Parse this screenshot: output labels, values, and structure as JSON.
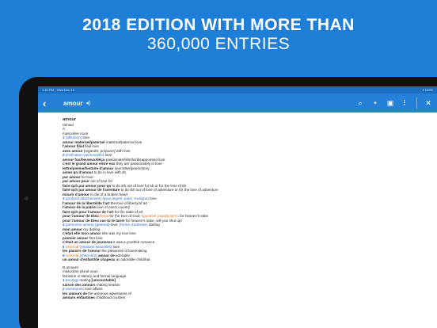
{
  "headline": {
    "line1": "2018 EDITION WITH MORE THAN",
    "line2": "360,000 ENTRIES"
  },
  "status_bar": {
    "time": "1:42 PM",
    "date": "Wed Dec 13",
    "right": "▾ 100%"
  },
  "toolbar": {
    "back_icon": "‹",
    "search_term": "amour",
    "audio_icon": "◂)",
    "search_icon": "⌕",
    "mic_icon": "•",
    "camera_icon": "▣",
    "menu_icon": "⠇",
    "close_icon": "✕"
  },
  "entry": {
    "headword": "amour",
    "pronunciation": "/amuʁ/",
    "sense_a": "A",
    "sense_a_pos": "masculine noun",
    "lines": [
      [
        {
          "c": "num",
          "t": "1 "
        },
        {
          "c": "blue",
          "t": "(affection) "
        },
        {
          "t": "love"
        }
      ],
      [
        {
          "c": "b",
          "t": "amour maternel/paternel "
        },
        {
          "t": "maternal/paternal love"
        }
      ],
      [
        {
          "c": "b",
          "t": "l'amour filial "
        },
        {
          "t": "filial love"
        }
      ],
      [
        {
          "c": "b",
          "t": "avec amour "
        },
        {
          "c": "ital",
          "t": "[regarder, préparer] "
        },
        {
          "t": "with love"
        }
      ],
      [
        {
          "c": "num",
          "t": "2 "
        },
        {
          "c": "blue",
          "t": "(inclination personnelle) "
        },
        {
          "t": "love"
        }
      ],
      [
        {
          "c": "b",
          "t": "amour fou/heureux/déçu "
        },
        {
          "t": "passionate/blissful/disappointed love"
        }
      ],
      [
        {
          "c": "b",
          "t": "c'est le grand amour entre eux "
        },
        {
          "t": "they are passionately in love"
        }
      ],
      [
        {
          "c": "b",
          "t": "lettre/poème/histoire d'amour "
        },
        {
          "t": "love letter/poem/story"
        }
      ],
      [
        {
          "c": "b",
          "t": "aimer qn d'amour "
        },
        {
          "t": "to be in love with sb"
        }
      ],
      [
        {
          "c": "b",
          "t": "par amour "
        },
        {
          "t": "for love"
        }
      ],
      [
        {
          "c": "b",
          "t": "par amour pour "
        },
        {
          "t": "out of love for"
        }
      ],
      [
        {
          "c": "b",
          "t": "faire qch par amour pour qn "
        },
        {
          "t": "to do sth out of love for sb or for the love of sb"
        }
      ],
      [
        {
          "c": "b",
          "t": "faire qch par amour de l'aventure "
        },
        {
          "t": "to do sth out of love of adventure or for the love of adventure"
        }
      ],
      [
        {
          "c": "b",
          "t": "mourir d'amour "
        },
        {
          "t": "to die of a broken heart"
        }
      ],
      [
        {
          "c": "num",
          "t": "3 "
        },
        {
          "c": "blue",
          "t": "(profond attachement) (pour argent, pays, musique) "
        },
        {
          "t": "love"
        }
      ],
      [
        {
          "c": "b",
          "t": "l'amour de la liberté/de l'art "
        },
        {
          "t": "the love of liberty/of art"
        }
      ],
      [
        {
          "c": "b",
          "t": "l'amour de la patrie "
        },
        {
          "t": "love of one's country"
        }
      ],
      [
        {
          "c": "b",
          "t": "faire qch pour l'amour de l'art "
        },
        {
          "t": "for the sake of art"
        }
      ],
      [
        {
          "c": "b",
          "t": "pour l'amour de Dieu "
        },
        {
          "c": "orange",
          "t": "literal "
        },
        {
          "t": "for the love of God; "
        },
        {
          "c": "orange",
          "t": "figurative (supplication) "
        },
        {
          "t": "for heaven's sake"
        }
      ],
      [
        {
          "c": "b",
          "t": "pour l'amour de Dieu vas-tu te taire! "
        },
        {
          "t": "for heaven's sake, will you shut up!"
        }
      ],
      [
        {
          "c": "num",
          "t": "4 "
        },
        {
          "c": "blue",
          "t": "(personne aimée) (général) "
        },
        {
          "t": "love; "
        },
        {
          "c": "blue",
          "t": "(forme d'adresse) "
        },
        {
          "t": "darling"
        }
      ],
      [
        {
          "c": "b",
          "t": "mon amour "
        },
        {
          "t": "my darling"
        }
      ],
      [
        {
          "c": "b",
          "t": "c'était elle mon amour "
        },
        {
          "t": "she was my true love"
        }
      ],
      [
        {
          "c": "b",
          "t": "premier amour "
        },
        {
          "t": "first love"
        }
      ],
      [
        {
          "c": "b",
          "t": "c'était un amour de jeunesse "
        },
        {
          "t": "it was a youthful romance"
        }
      ],
      [
        {
          "c": "num",
          "t": "5 "
        },
        {
          "c": "orange",
          "t": "informal "
        },
        {
          "c": "blue",
          "t": "(relations sexuelles) "
        },
        {
          "t": "love"
        }
      ],
      [
        {
          "c": "b",
          "t": "les plaisirs de l'amour "
        },
        {
          "t": "the pleasures of lovemaking"
        }
      ],
      [
        {
          "c": "num",
          "t": "6 "
        },
        {
          "c": "orange",
          "t": "informal "
        },
        {
          "c": "blue",
          "t": "(charmant) "
        },
        {
          "c": "b",
          "t": "amour de "
        },
        {
          "t": "adorable"
        }
      ],
      [
        {
          "c": "b",
          "t": "un amour d'enfant/de chapeau "
        },
        {
          "t": "an adorable child/hat"
        }
      ]
    ],
    "sense_b": "B amours",
    "sense_b_pos": "masculine plural noun",
    "sense_b_note": "feminine in literary and formal language",
    "lines_b": [
      [
        {
          "c": "num",
          "t": "1 "
        },
        {
          "c": "blue",
          "t": "Zoology "
        },
        {
          "t": "mating "
        },
        {
          "c": "b",
          "t": "[uncountable]"
        }
      ],
      [
        {
          "c": "b",
          "t": "saison des amours "
        },
        {
          "t": "mating season"
        }
      ],
      [
        {
          "c": "num",
          "t": "2 "
        },
        {
          "c": "blue",
          "t": "(aventures) "
        },
        {
          "t": "love affairs"
        }
      ],
      [
        {
          "c": "b",
          "t": "les amours de "
        },
        {
          "t": "the amorous adventures of"
        }
      ],
      [
        {
          "c": "b",
          "t": "amours enfantines "
        },
        {
          "t": "childhood crushes"
        }
      ]
    ]
  }
}
